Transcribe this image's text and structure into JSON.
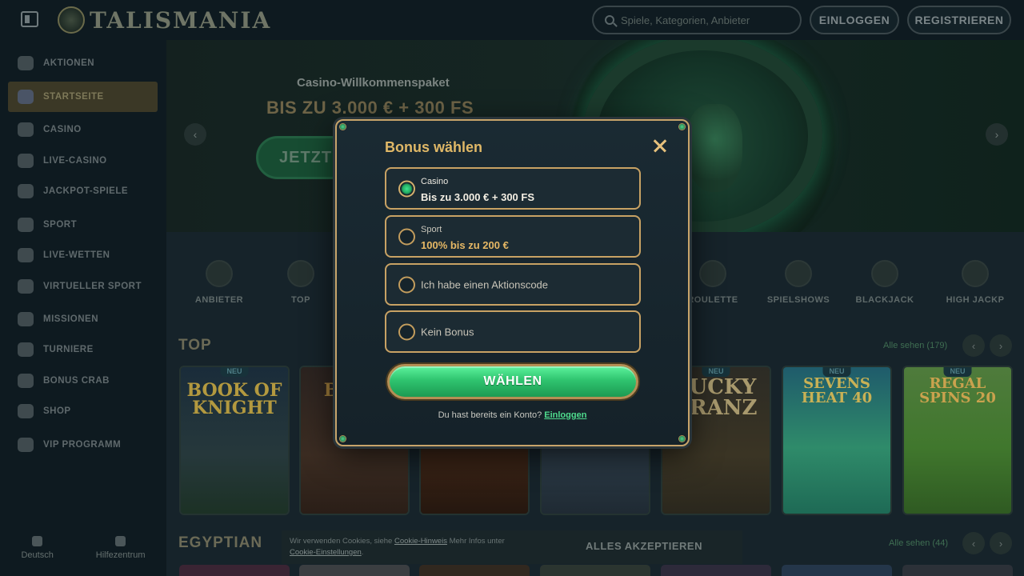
{
  "header": {
    "logo_text": "TALISMANIA",
    "search_placeholder": "Spiele, Kategorien, Anbieter",
    "login_label": "EINLOGGEN",
    "register_label": "REGISTRIEREN"
  },
  "sidebar": {
    "items": [
      {
        "label": "AKTIONEN",
        "icon": "gift-icon"
      },
      {
        "label": "STARTSEITE",
        "icon": "home-icon",
        "active": true
      },
      {
        "label": "CASINO",
        "icon": "casino-icon"
      },
      {
        "label": "LIVE-CASINO",
        "icon": "live-casino-icon"
      },
      {
        "label": "JACKPOT-SPIELE",
        "icon": "jackpot-icon"
      },
      {
        "label": "SPORT",
        "icon": "sport-icon"
      },
      {
        "label": "LIVE-WETTEN",
        "icon": "live-bet-icon"
      },
      {
        "label": "VIRTUELLER SPORT",
        "icon": "virtual-sport-icon"
      },
      {
        "label": "MISSIONEN",
        "icon": "missions-icon"
      },
      {
        "label": "TURNIERE",
        "icon": "trophy-icon"
      },
      {
        "label": "BONUS CRAB",
        "icon": "crab-icon"
      },
      {
        "label": "SHOP",
        "icon": "shop-icon"
      },
      {
        "label": "VIP PROGRAMM",
        "icon": "diamond-icon"
      }
    ],
    "bottom": {
      "language": "Deutsch",
      "help": "Hilfezentrum"
    }
  },
  "hero": {
    "subtitle": "Casino-Willkommenspaket",
    "title": "BIS ZU 3.000 € + 300 FS",
    "cta": "JETZT"
  },
  "categories": [
    {
      "label": "ANBIETER"
    },
    {
      "label": "TOP"
    },
    {
      "label": "ROULETTE"
    },
    {
      "label": "SPIELSHOWS"
    },
    {
      "label": "BLACKJACK"
    },
    {
      "label": "HIGH JACKP"
    }
  ],
  "sections": {
    "top": {
      "title": "TOP",
      "see_all": "Alle sehen (179)"
    },
    "egyptian": {
      "title": "EGYPTIAN",
      "see_all": "Alle sehen (44)"
    }
  },
  "games": [
    {
      "name": "BOOK OF KNIGHT",
      "new": "NEU"
    },
    {
      "name": "BOOK",
      "new": ""
    },
    {
      "name": "",
      "new": ""
    },
    {
      "name": "",
      "new": ""
    },
    {
      "name": "LUCKY FRANZ",
      "new": "NEU"
    },
    {
      "name": "SEVENS HEAT 40",
      "new": "NEU"
    },
    {
      "name": "REGAL SPINS 20",
      "new": "NEU"
    }
  ],
  "cookie": {
    "text_before": "Wir verwenden Cookies, siehe ",
    "link1": "Cookie-Hinweis",
    "text_middle": " Mehr Infos unter ",
    "link2": "Cookie-Einstellungen",
    "text_after": ".",
    "accept": "ALLES AKZEPTIEREN"
  },
  "modal": {
    "title": "Bonus wählen",
    "options": [
      {
        "kicker": "Casino",
        "value": "Bis zu 3.000 € + 300 FS",
        "selected": true
      },
      {
        "kicker": "Sport",
        "value": "100% bis zu 200 €",
        "selected": false
      },
      {
        "single": "Ich habe einen Aktionscode",
        "selected": false
      },
      {
        "single": "Kein Bonus",
        "selected": false
      }
    ],
    "submit": "WÄHLEN",
    "footer_text": "Du hast bereits ein Konto?",
    "footer_link": "Einloggen"
  },
  "colors": {
    "accent_gold": "#c8a264",
    "accent_green": "#2fc46f",
    "modal_bg": "#1a2a33"
  }
}
